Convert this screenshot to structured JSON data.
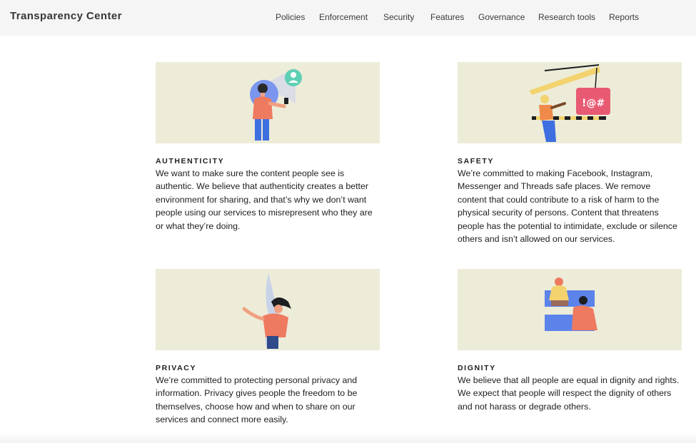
{
  "header": {
    "brand": "Transparency Center",
    "nav": [
      "Policies",
      "Enforcement",
      "Security",
      "Features",
      "Governance",
      "Research tools",
      "Reports"
    ]
  },
  "colors": {
    "illustration_bg": "#edecd8",
    "header_bg": "#f5f5f5",
    "text": "#1c1e21"
  },
  "cards": [
    {
      "title": "AUTHENTICITY",
      "description": "We want to make sure the content people see is authentic. We believe that authenticity creates a better environment for sharing, and that’s why we don’t want people using our services to misrepresent who they are or what they’re doing.",
      "illustration": "person-with-phone-illustration"
    },
    {
      "title": "SAFETY",
      "description": "We’re committed to making Facebook, Instagram, Messenger and Threads safe places. We remove content that could contribute to a risk of harm to the physical security of persons. Content that threatens people has the potential to intimidate, exclude or silence others and isn’t allowed on our services.",
      "illustration": "construction-worker-illustration"
    },
    {
      "title": "PRIVACY",
      "description": "We’re committed to protecting personal privacy and information. Privacy gives people the freedom to be themselves, choose how and when to share on our services and connect more easily.",
      "illustration": "person-behind-curtain-illustration"
    },
    {
      "title": "DIGNITY",
      "description": "We believe that all people are equal in dignity and rights. We expect that people will respect the dignity of others and not harass or degrade others.",
      "illustration": "two-people-illustration"
    }
  ]
}
